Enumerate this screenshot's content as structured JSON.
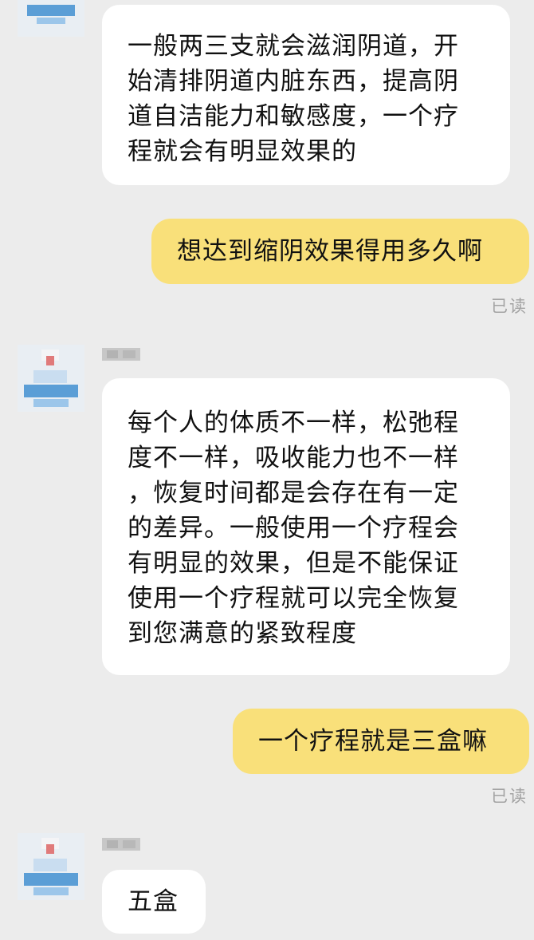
{
  "messages": [
    {
      "lines": [
        "一般两三支就会滋润阴道，开",
        "始清排阴道内脏东西，提高阴",
        "道自洁能力和敏感度，一个疗",
        "程就会有明显效果的"
      ]
    },
    {
      "text": "想达到缩阴效果得用多久啊",
      "status": "已读"
    },
    {
      "lines": [
        "每个人的体质不一样，松弛程",
        "度不一样，吸收能力也不一样",
        "，恢复时间都是会存在有一定",
        "的差异。一般使用一个疗程会",
        "有明显的效果，但是不能保证",
        "使用一个疗程就可以完全恢复",
        "到您满意的紧致程度"
      ]
    },
    {
      "text": "一个疗程就是三盒嘛",
      "status": "已读"
    },
    {
      "text": "五盒"
    }
  ],
  "colors": {
    "background": "#ececec",
    "incoming_bubble": "#ffffff",
    "outgoing_bubble": "#f9e07a",
    "read_status": "#a3a3a3"
  }
}
